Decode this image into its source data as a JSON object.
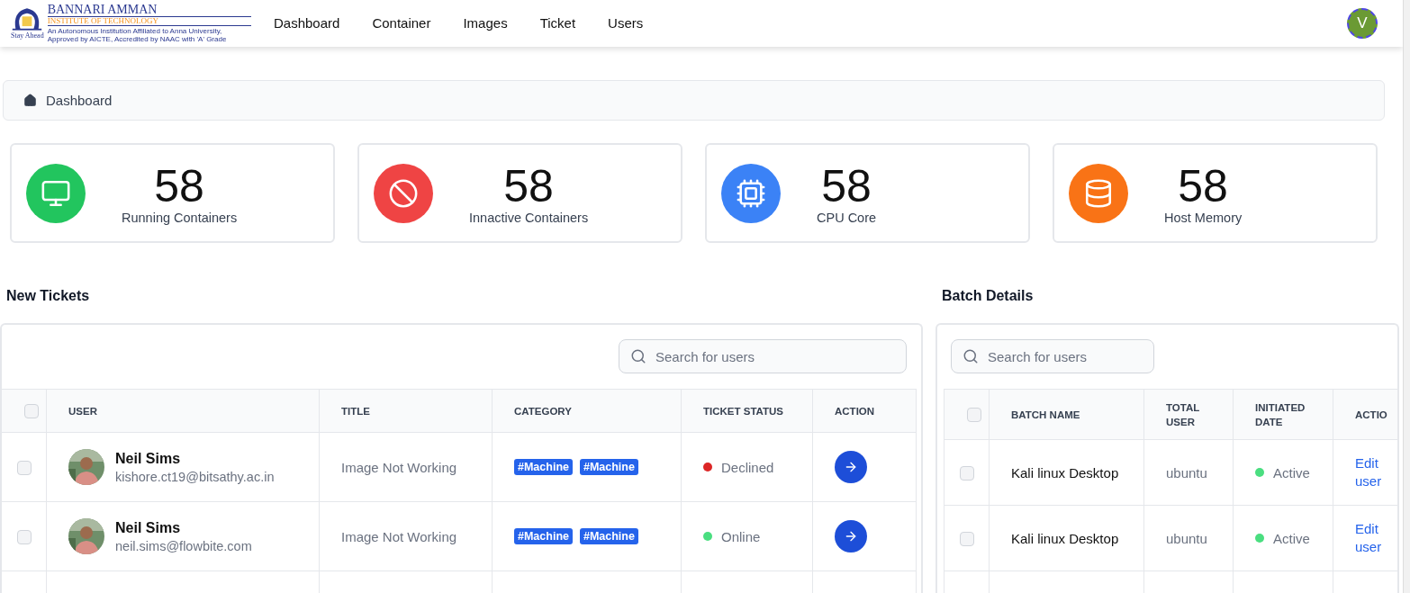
{
  "header": {
    "logo": {
      "name": "BANNARI AMMAN",
      "subtitle": "INSTITUTE OF TECHNOLOGY",
      "fine_print": "An Autonomous Institution Affiliated to Anna University, Approved by AICTE, Accredited by NAAC with 'A' Grade",
      "motto": "Stay Ahead"
    },
    "nav": [
      {
        "label": "Dashboard"
      },
      {
        "label": "Container"
      },
      {
        "label": "Images"
      },
      {
        "label": "Ticket"
      },
      {
        "label": "Users"
      }
    ],
    "avatar": {
      "initial": "V"
    }
  },
  "breadcrumb": {
    "label": "Dashboard"
  },
  "stats": [
    {
      "kind": "monitor",
      "value": "58",
      "label": "Running Containers",
      "color": "#22c55e"
    },
    {
      "kind": "ban",
      "value": "58",
      "label": "Innactive Containers",
      "color": "#ef4444"
    },
    {
      "kind": "cpu",
      "value": "58",
      "label": "CPU Core",
      "color": "#3b82f6"
    },
    {
      "kind": "database",
      "value": "58",
      "label": "Host Memory",
      "color": "#f97316"
    }
  ],
  "tickets": {
    "title": "New Tickets",
    "search": {
      "placeholder": "Search for users"
    },
    "columns": [
      "USER",
      "TITLE",
      "CATEGORY",
      "TICKET STATUS",
      "ACTION"
    ],
    "header_checked": false,
    "rows": [
      {
        "checked": false,
        "name": "Neil Sims",
        "email": "kishore.ct19@bitsathy.ac.in",
        "title": "Image Not Working",
        "tags": [
          "#Machine",
          "#Machine"
        ],
        "status": "Declined",
        "color": "#dc2626"
      },
      {
        "checked": false,
        "name": "Neil Sims",
        "email": "neil.sims@flowbite.com",
        "title": "Image Not Working",
        "tags": [
          "#Machine",
          "#Machine"
        ],
        "status": "Online",
        "color": "#4ade80"
      }
    ]
  },
  "batches": {
    "title": "Batch Details",
    "search": {
      "placeholder": "Search for users"
    },
    "columns": [
      "BATCH NAME",
      "TOTAL USER",
      "INITIATED DATE",
      "ACTIO"
    ],
    "header_checked": false,
    "rows": [
      {
        "checked": false,
        "name": "Kali linux Desktop",
        "total": "ubuntu",
        "status": "Active",
        "color": "#4ade80",
        "action": "Edit user"
      },
      {
        "checked": false,
        "name": "Kali linux Desktop",
        "total": "ubuntu",
        "status": "Active",
        "color": "#4ade80",
        "action": "Edit user"
      }
    ]
  }
}
